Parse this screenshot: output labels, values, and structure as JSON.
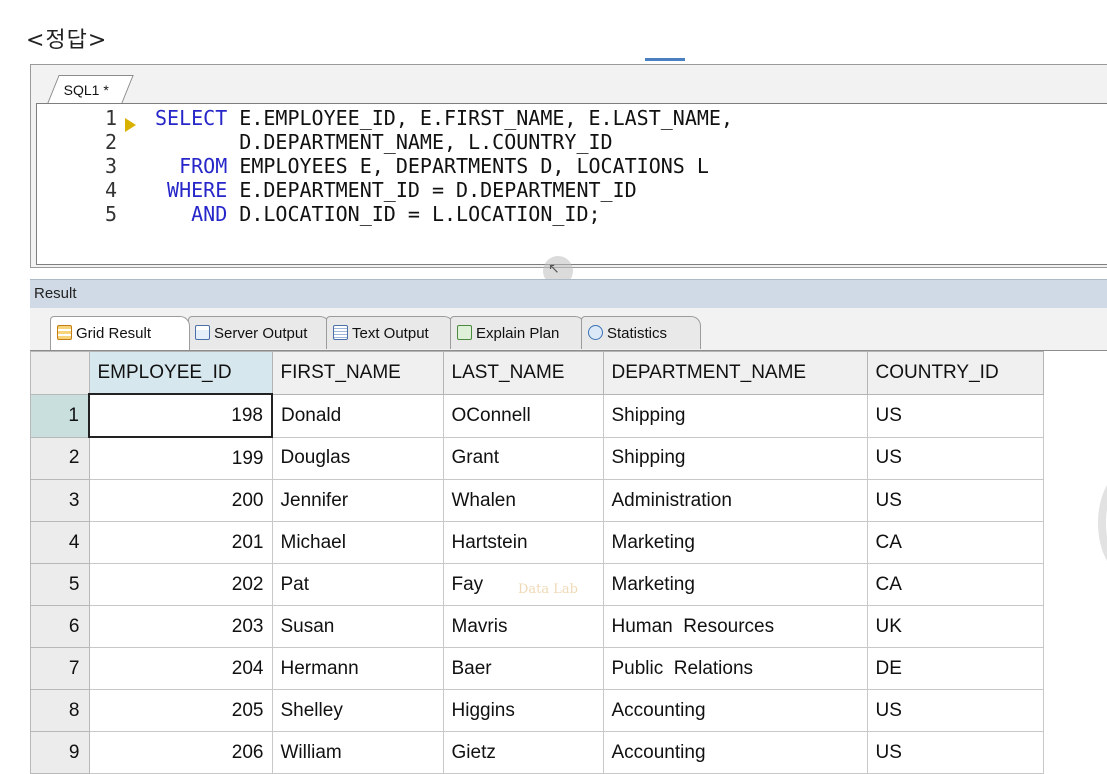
{
  "page_heading": "<정답>",
  "editor": {
    "tab_label": "SQL1 *",
    "lines": [
      {
        "num": "1",
        "kw": "SELECT",
        "code": "E.EMPLOYEE_ID, E.FIRST_NAME, E.LAST_NAME,"
      },
      {
        "num": "2",
        "kw": "",
        "code": "D.DEPARTMENT_NAME, L.COUNTRY_ID"
      },
      {
        "num": "3",
        "kw": "FROM",
        "code": "EMPLOYEES E, DEPARTMENTS D, LOCATIONS L"
      },
      {
        "num": "4",
        "kw": "WHERE",
        "code": "E.DEPARTMENT_ID = D.DEPARTMENT_ID"
      },
      {
        "num": "5",
        "kw": "AND",
        "code": "D.LOCATION_ID = L.LOCATION_ID;"
      }
    ]
  },
  "result": {
    "panel_title": "Result",
    "tabs": [
      "Grid Result",
      "Server Output",
      "Text Output",
      "Explain Plan",
      "Statistics"
    ],
    "columns": [
      "EMPLOYEE_ID",
      "FIRST_NAME",
      "LAST_NAME",
      "DEPARTMENT_NAME",
      "COUNTRY_ID"
    ],
    "rows": [
      [
        "1",
        "198",
        "Donald",
        "OConnell",
        "Shipping",
        "US"
      ],
      [
        "2",
        "199",
        "Douglas",
        "Grant",
        "Shipping",
        "US"
      ],
      [
        "3",
        "200",
        "Jennifer",
        "Whalen",
        "Administration",
        "US"
      ],
      [
        "4",
        "201",
        "Michael",
        "Hartstein",
        "Marketing",
        "CA"
      ],
      [
        "5",
        "202",
        "Pat",
        "Fay",
        "Marketing",
        "CA"
      ],
      [
        "6",
        "203",
        "Susan",
        "Mavris",
        "Human  Resources",
        "UK"
      ],
      [
        "7",
        "204",
        "Hermann",
        "Baer",
        "Public  Relations",
        "DE"
      ],
      [
        "8",
        "205",
        "Shelley",
        "Higgins",
        "Accounting",
        "US"
      ],
      [
        "9",
        "206",
        "William",
        "Gietz",
        "Accounting",
        "US"
      ]
    ]
  },
  "watermark": "Data Lab",
  "colors": {
    "keyword": "#2727c9",
    "result_bar": "#cfdae6",
    "selected_header": "#d7e7ee"
  }
}
